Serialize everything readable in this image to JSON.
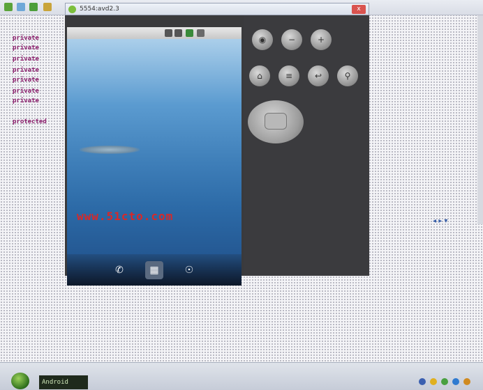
{
  "emulator": {
    "title": "5554:avd2.3",
    "close_label": "x",
    "status_time": "",
    "watermark": "www.51cto.com",
    "dock": {
      "phone_icon": "phone-icon",
      "apps_icon": "apps-grid-icon",
      "browser_icon": "globe-icon"
    }
  },
  "ide_code": [
    {
      "kw": "private",
      "tx": ""
    },
    {
      "kw": "private",
      "tx": ""
    },
    {
      "kw": "private",
      "tx": ""
    },
    {
      "kw": "private",
      "tx": ""
    },
    {
      "kw": "private",
      "tx": ""
    },
    {
      "kw": "private",
      "tx": ""
    },
    {
      "kw": "private",
      "tx": ""
    },
    {
      "kw": "protected",
      "tx": ""
    }
  ],
  "taskbar": {
    "task_label": "Android"
  },
  "colors": {
    "accent": "#7cbf3c",
    "watermark": "#d82828",
    "close": "#d9534f"
  }
}
